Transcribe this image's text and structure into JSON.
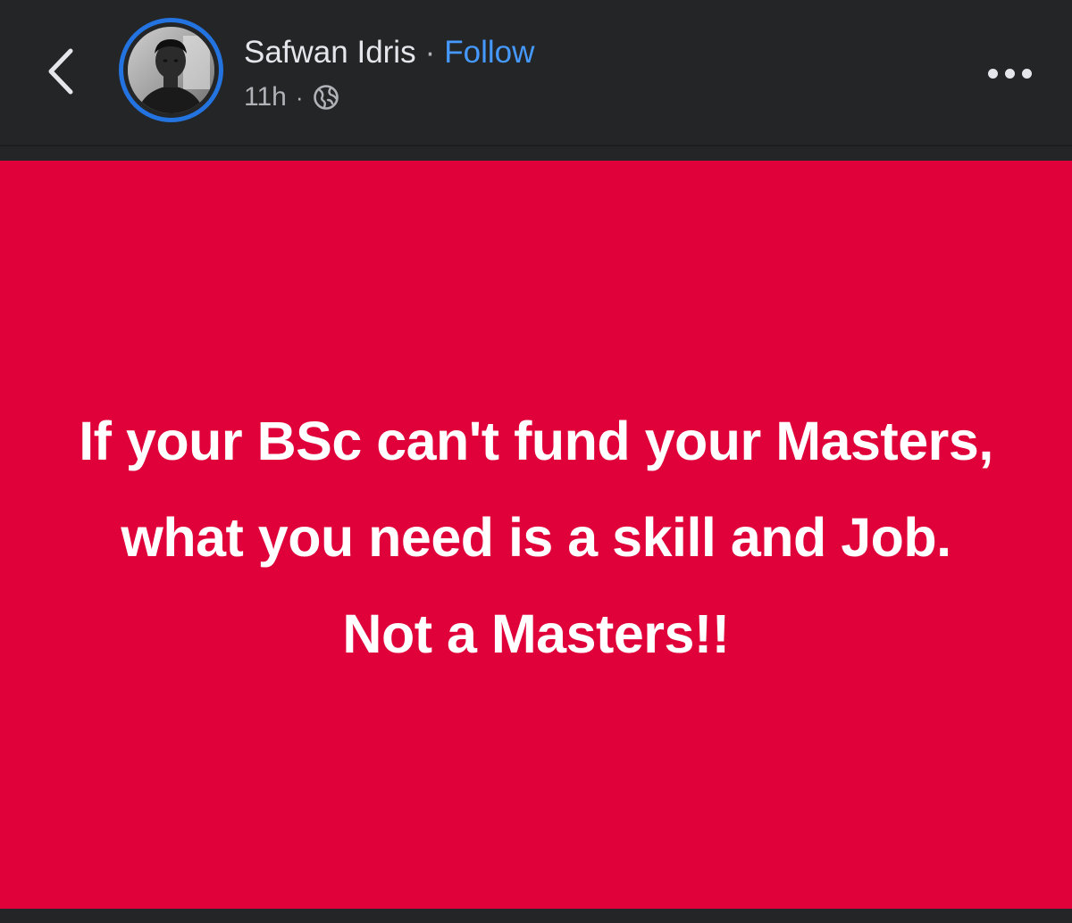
{
  "header": {
    "author_name": "Safwan Idris",
    "separator": "·",
    "follow_label": "Follow",
    "timestamp": "11h",
    "meta_separator": "·",
    "audience_icon": "globe-icon",
    "back_icon": "chevron-left-icon",
    "more_icon": "more-horizontal-icon"
  },
  "post": {
    "text": "If your BSc can't fund your Masters, what you need is a skill and Job. Not a Masters!!",
    "background_color": "#e0003a",
    "text_color": "#ffffff"
  },
  "colors": {
    "app_background": "#242526",
    "accent": "#4599ff",
    "avatar_ring": "#2374e1"
  }
}
